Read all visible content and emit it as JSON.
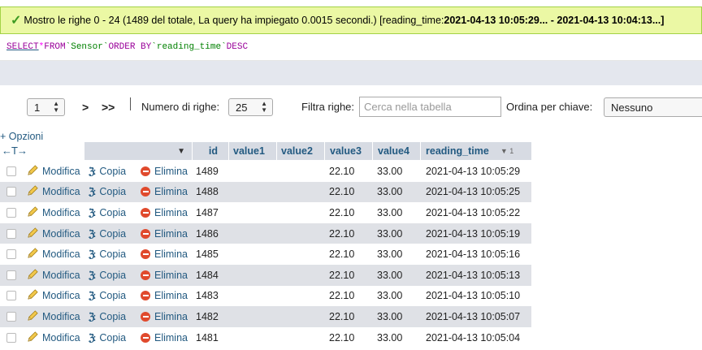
{
  "success": {
    "prefix": "Mostro le righe 0 - 24 (1489 del totale, La query ha impiegato 0.0015 secondi.) [reading_time: ",
    "range": "2021-04-13 10:05:29... - 2021-04-13 10:04:13...]"
  },
  "sql": {
    "select": "SELECT",
    "star": "*",
    "from": "FROM",
    "table": "`Sensor`",
    "order_by": "ORDER BY",
    "column": "`reading_time`",
    "dir": "DESC"
  },
  "nav": {
    "page": "1",
    "next": ">",
    "last": ">>",
    "rows_label": "Numero di righe:",
    "rows_value": "25",
    "filter_label": "Filtra righe:",
    "filter_placeholder": "Cerca nella tabella",
    "sort_label": "Ordina per chiave:",
    "sort_value": "Nessuno"
  },
  "options_label": "+ Opzioni",
  "arrows_label": "←T→",
  "columns": {
    "id": "id",
    "value1": "value1",
    "value2": "value2",
    "value3": "value3",
    "value4": "value4",
    "reading_time": "reading_time",
    "sort_indicator": "▼ 1"
  },
  "actions": {
    "edit": "Modifica",
    "copy": "Copia",
    "delete": "Elimina"
  },
  "rows": [
    {
      "id": "1489",
      "value3": "22.10",
      "value4": "33.00",
      "reading_time": "2021-04-13 10:05:29"
    },
    {
      "id": "1488",
      "value3": "22.10",
      "value4": "33.00",
      "reading_time": "2021-04-13 10:05:25"
    },
    {
      "id": "1487",
      "value3": "22.10",
      "value4": "33.00",
      "reading_time": "2021-04-13 10:05:22"
    },
    {
      "id": "1486",
      "value3": "22.10",
      "value4": "33.00",
      "reading_time": "2021-04-13 10:05:19"
    },
    {
      "id": "1485",
      "value3": "22.10",
      "value4": "33.00",
      "reading_time": "2021-04-13 10:05:16"
    },
    {
      "id": "1484",
      "value3": "22.10",
      "value4": "33.00",
      "reading_time": "2021-04-13 10:05:13"
    },
    {
      "id": "1483",
      "value3": "22.10",
      "value4": "33.00",
      "reading_time": "2021-04-13 10:05:10"
    },
    {
      "id": "1482",
      "value3": "22.10",
      "value4": "33.00",
      "reading_time": "2021-04-13 10:05:07"
    },
    {
      "id": "1481",
      "value3": "22.10",
      "value4": "33.00",
      "reading_time": "2021-04-13 10:05:04"
    }
  ]
}
